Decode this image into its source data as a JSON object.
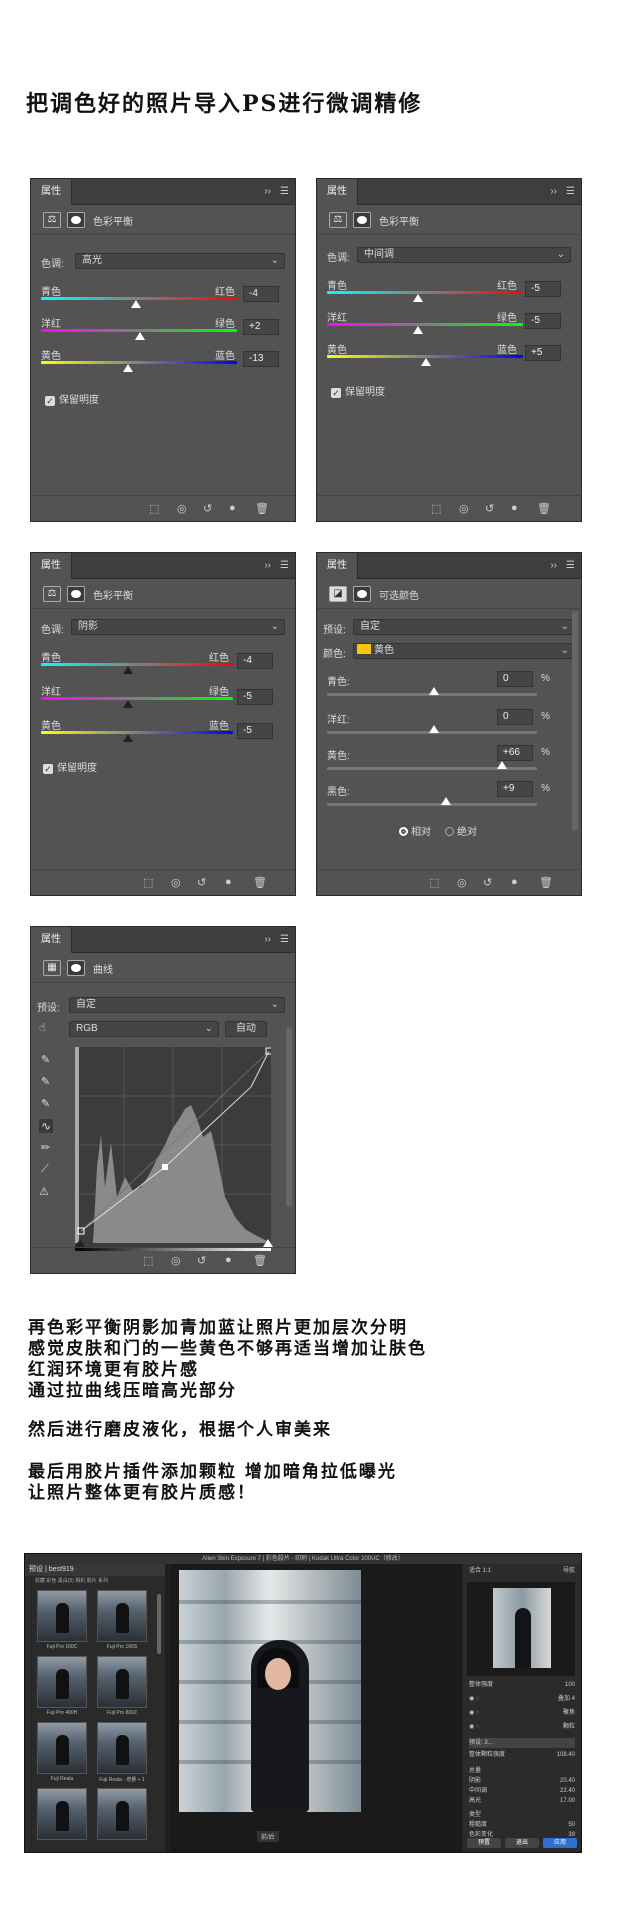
{
  "heading": "把调色好的照片导入PS进行微调精修",
  "panel_tab": "属性",
  "panels": {
    "cb_highlight": {
      "title": "色彩平衡",
      "tone_label": "色调:",
      "tone": "高光",
      "sliders": [
        {
          "left": "青色",
          "right": "红色",
          "value": "-4"
        },
        {
          "left": "洋红",
          "right": "绿色",
          "value": "+2"
        },
        {
          "left": "黄色",
          "right": "蓝色",
          "value": "-13"
        }
      ],
      "preserve": "保留明度"
    },
    "cb_midtone": {
      "title": "色彩平衡",
      "tone_label": "色调:",
      "tone": "中间调",
      "sliders": [
        {
          "left": "青色",
          "right": "红色",
          "value": "-5"
        },
        {
          "left": "洋红",
          "right": "绿色",
          "value": "-5"
        },
        {
          "left": "黄色",
          "right": "蓝色",
          "value": "+5"
        }
      ],
      "preserve": "保留明度"
    },
    "cb_shadow": {
      "title": "色彩平衡",
      "tone_label": "色调:",
      "tone": "阴影",
      "sliders": [
        {
          "left": "青色",
          "right": "红色",
          "value": "-4"
        },
        {
          "left": "洋红",
          "right": "绿色",
          "value": "-5"
        },
        {
          "left": "黄色",
          "right": "蓝色",
          "value": "-5"
        }
      ],
      "preserve": "保留明度"
    },
    "selective": {
      "title": "可选颜色",
      "preset_label": "预设:",
      "preset": "自定",
      "color_label": "颜色:",
      "color": "黄色",
      "color_swatch": "#f5c800",
      "rows": [
        {
          "label": "青色:",
          "value": "0",
          "unit": "%"
        },
        {
          "label": "洋红:",
          "value": "0",
          "unit": "%"
        },
        {
          "label": "黄色:",
          "value": "+66",
          "unit": "%"
        },
        {
          "label": "黑色:",
          "value": "+9",
          "unit": "%"
        }
      ],
      "relative": "相对",
      "absolute": "绝对"
    },
    "curves": {
      "title": "曲线",
      "preset_label": "预设:",
      "preset": "自定",
      "channel": "RGB",
      "auto": "自动"
    }
  },
  "body_lines": [
    "再色彩平衡阴影加青加蓝让照片更加层次分明",
    "感觉皮肤和门的一些黄色不够再适当增加让肤色",
    "红润环境更有胶片感",
    "通过拉曲线压暗高光部分"
  ],
  "body_line2": "然后进行磨皮液化，根据个人审美来",
  "body_lines3": [
    "最后用胶片插件添加颗粒 增加暗角拉低曝光",
    "让照片整体更有胶片质感！"
  ],
  "exposure": {
    "title": "Alien Skin Exposure 7 | 彩色胶片 - 印刷 | Kodak Ultra Color 100UC（修改）",
    "preset_header": "预设 | best919",
    "left_tabs": "收藏  彩色  黑白(5)  相机  胶片  系列",
    "thumbs": [
      "Fuji Pro 160C",
      "Fuji Pro 160S",
      "Fuji Pro 400H",
      "Fuji Pro 800Z",
      "Fuji Reala",
      "Fuji Reala - 增量 + 1"
    ],
    "right_header": "适合  1:1",
    "nav_label": "导航",
    "rows": [
      {
        "label": "整体强度",
        "value": "100"
      },
      {
        "label": "叠加",
        "value": "4"
      },
      {
        "label": "聚焦",
        "value": ""
      },
      {
        "label": "颗粒",
        "value": ""
      },
      {
        "label": "预设: 3…",
        "value": ""
      },
      {
        "label": "整体颗粒强度",
        "value": "108.40"
      },
      {
        "label": "总量",
        "value": ""
      },
      {
        "label": "阴影",
        "value": "20.40"
      },
      {
        "label": "中间调",
        "value": "22.40"
      },
      {
        "label": "高光",
        "value": "17.00"
      },
      {
        "label": "类型",
        "value": ""
      },
      {
        "label": "粗糙度",
        "value": "50"
      },
      {
        "label": "色彩变化",
        "value": "39"
      }
    ],
    "buttons": [
      "预置",
      "退出",
      "应用"
    ],
    "before_after": "前/后"
  }
}
